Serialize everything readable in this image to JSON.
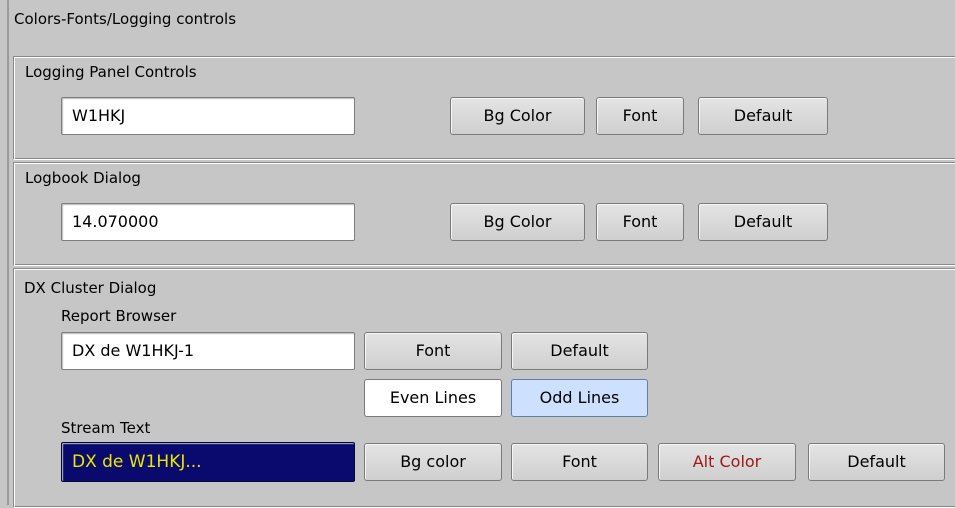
{
  "window": {
    "title": "Colors-Fonts/Logging controls"
  },
  "logging_panel": {
    "title": "Logging Panel Controls",
    "field_value": "W1HKJ",
    "bg_color_label": "Bg Color",
    "font_label": "Font",
    "default_label": "Default"
  },
  "logbook_dialog": {
    "title": "Logbook Dialog",
    "field_value": "14.070000",
    "bg_color_label": "Bg Color",
    "font_label": "Font",
    "default_label": "Default"
  },
  "dx_cluster": {
    "title": "DX Cluster Dialog",
    "report_browser": {
      "label": "Report Browser",
      "field_value": "DX de W1HKJ-1",
      "font_label": "Font",
      "default_label": "Default",
      "even_lines_label": "Even Lines",
      "odd_lines_label": "Odd Lines"
    },
    "stream_text": {
      "label": "Stream Text",
      "field_value": "DX de W1HKJ...",
      "bg_color_label": "Bg color",
      "font_label": "Font",
      "alt_color_label": "Alt Color",
      "default_label": "Default"
    }
  },
  "colors": {
    "window_bg": "#c6c6c6",
    "stream_text_bg": "#0a0a6e",
    "stream_text_fg": "#e8e800",
    "alt_color_text": "#a01818",
    "odd_lines_bg": "#cde1ff",
    "even_lines_bg": "#ffffff"
  }
}
